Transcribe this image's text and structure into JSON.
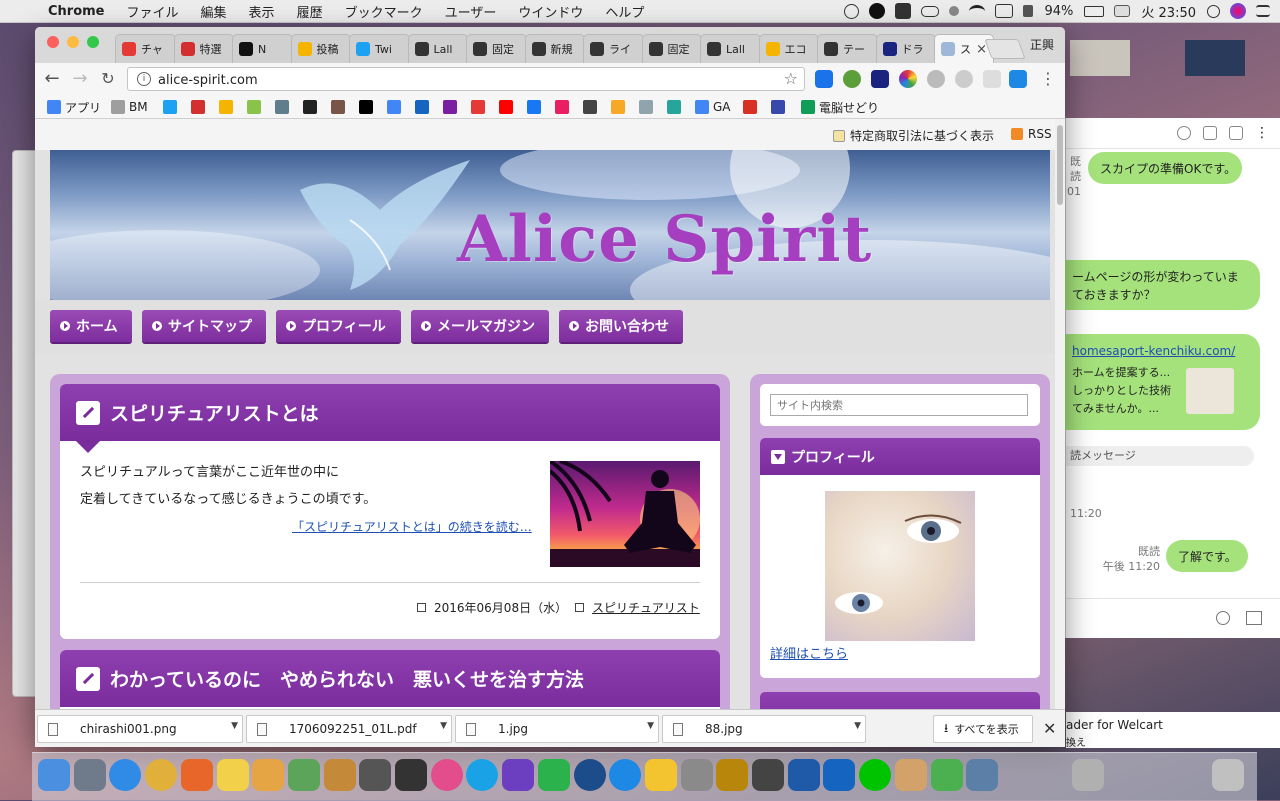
{
  "menubar": {
    "app": "Chrome",
    "items": [
      "ファイル",
      "編集",
      "表示",
      "履歴",
      "ブックマーク",
      "ユーザー",
      "ウインドウ",
      "ヘルプ"
    ],
    "battery": "94%",
    "clock": "火 23:50"
  },
  "chrome": {
    "tabs": [
      {
        "label": "チャ",
        "color": "#e53935"
      },
      {
        "label": "特選",
        "color": "#d32f2f"
      },
      {
        "label": "N",
        "color": "#111111"
      },
      {
        "label": "投稿",
        "color": "#f4b400"
      },
      {
        "label": "Twi",
        "color": "#1da1f2"
      },
      {
        "label": "Lall",
        "color": "#333333"
      },
      {
        "label": "固定",
        "color": "#333333"
      },
      {
        "label": "新規",
        "color": "#333333"
      },
      {
        "label": "ライ",
        "color": "#333333"
      },
      {
        "label": "固定",
        "color": "#333333"
      },
      {
        "label": "Lall",
        "color": "#333333"
      },
      {
        "label": "エコ",
        "color": "#f4b400"
      },
      {
        "label": "テー",
        "color": "#333333"
      },
      {
        "label": "ドラ",
        "color": "#1a237e"
      },
      {
        "label": "ス",
        "color": "#9fb7d8",
        "active": true
      }
    ],
    "profile": "正興",
    "url": "alice-spirit.com",
    "bookmarks": [
      {
        "label": "アプリ",
        "color": "#4285f4"
      },
      {
        "label": "BM",
        "color": "#9e9e9e"
      },
      {
        "label": "",
        "color": "#1da1f2"
      },
      {
        "label": "",
        "color": "#d32f2f"
      },
      {
        "label": "",
        "color": "#f4b400"
      },
      {
        "label": "",
        "color": "#8bc34a"
      },
      {
        "label": "",
        "color": "#607d8b"
      },
      {
        "label": "",
        "color": "#222222"
      },
      {
        "label": "",
        "color": "#795548"
      },
      {
        "label": "",
        "color": "#000000"
      },
      {
        "label": "",
        "color": "#4285f4"
      },
      {
        "label": "",
        "color": "#1565c0"
      },
      {
        "label": "",
        "color": "#7b1fa2"
      },
      {
        "label": "",
        "color": "#e53935"
      },
      {
        "label": "",
        "color": "#ff0000"
      },
      {
        "label": "",
        "color": "#1877f2"
      },
      {
        "label": "",
        "color": "#e91e63"
      },
      {
        "label": "",
        "color": "#444444"
      },
      {
        "label": "",
        "color": "#f9a825"
      },
      {
        "label": "",
        "color": "#90a4ae"
      },
      {
        "label": "",
        "color": "#26a69a"
      },
      {
        "label": "GA",
        "color": "#4285f4"
      },
      {
        "label": "",
        "color": "#d93025"
      },
      {
        "label": "",
        "color": "#3949ab"
      },
      {
        "label": "電脳せどり",
        "color": "#0f9d58"
      }
    ]
  },
  "page": {
    "top_links": {
      "tokutei": "特定商取引法に基づく表示",
      "rss": "RSS"
    },
    "site_title": "Alice Spirit",
    "nav": [
      "ホーム",
      "サイトマップ",
      "プロフィール",
      "メールマガジン",
      "お問い合わせ"
    ],
    "articles": [
      {
        "title": "スピリチュアリストとは",
        "lines": [
          "スピリチュアルって言葉がここ近年世の中に",
          "定着してきているなって感じるきょうこの頃です。"
        ],
        "readmore": "「スピリチュアリストとは」の続きを読む…",
        "date": "2016年06月08日（水）",
        "category": "スピリチュアリスト"
      },
      {
        "title": "わかっているのに　やめられない　悪いくせを治す方法"
      }
    ],
    "sidebar": {
      "search_placeholder": "サイト内検索",
      "profile_heading": "プロフィール",
      "detail_link": "詳細はこちら"
    }
  },
  "line_chat": {
    "messages": [
      {
        "text": "スカイプの準備OKです。",
        "read": "既読",
        "time": "01"
      },
      {
        "text": "ームページの形が変わっていま\nておきますか？"
      },
      {
        "text": "homesaport-kenchiku.com/"
      },
      {
        "text": "ホームを提案する...\nしっかりとした技術\nてみませんか。..."
      },
      {
        "text": "読メッセージ"
      },
      {
        "text": "11:20"
      },
      {
        "text": "了解です。",
        "read": "既読",
        "time": "午後 11:20"
      }
    ],
    "bottom_text": [
      "ader for Welcart",
      "換え"
    ]
  },
  "downloads": {
    "items": [
      "chirashi001.png",
      "1706092251_01L.pdf",
      "1.jpg",
      "88.jpg"
    ],
    "show_all": "すべてを表示"
  },
  "dock": {
    "icons": [
      "finder-icon",
      "launchpad-icon",
      "safari-icon",
      "chrome-icon",
      "firefox-icon",
      "notes-icon",
      "pages-icon",
      "maps-icon",
      "photo-icon",
      "gif-icon",
      "film-icon",
      "itunes-icon",
      "skype-icon",
      "imovie-icon",
      "feedly-icon",
      "quicktime-icon",
      "appstore-icon",
      "cyberduck-icon",
      "prefs-icon",
      "audacity-icon",
      "dvd-icon",
      "network-icon",
      "virtualbox-icon",
      "line-icon",
      "archive-icon",
      "utorrent-icon",
      "preview-icon",
      "downloads-stack-icon",
      "trash-icon"
    ],
    "colors": [
      "#4a8fe0",
      "#6f7a8a",
      "#2f8be6",
      "#e0b03a",
      "#e8662a",
      "#f3d04a",
      "#e5a544",
      "#5ca45a",
      "#c48a3a",
      "#555555",
      "#333333",
      "#e34d8c",
      "#19a3e6",
      "#6b3fbf",
      "#2bb24c",
      "#1d4c8a",
      "#1e88e5",
      "#f4c430",
      "#8a8a8a",
      "#b8860b",
      "#444444",
      "#1e5aa8",
      "#1565c0",
      "#00c300",
      "#d2a26a",
      "#4caf50",
      "#5b7fa6",
      "#b0b0b0",
      "#c0c0c0"
    ]
  }
}
